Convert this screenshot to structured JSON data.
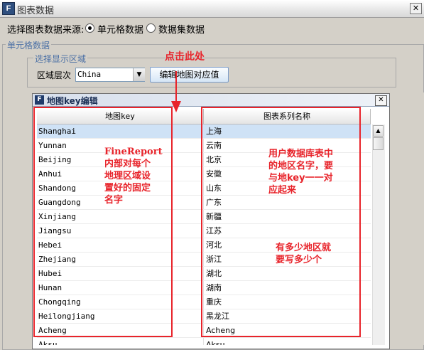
{
  "window": {
    "title": "图表数据",
    "close_glyph": "✕"
  },
  "source": {
    "label": "选择图表数据来源:",
    "options": [
      {
        "label": "单元格数据",
        "selected": true
      },
      {
        "label": "数据集数据",
        "selected": false
      }
    ]
  },
  "cell_group": {
    "legend": "单元格数据"
  },
  "display_group": {
    "legend": "选择显示区域"
  },
  "region": {
    "label": "区域层次",
    "value": "China"
  },
  "edit_button": {
    "label": "编辑地图对应值"
  },
  "map_key_dialog": {
    "title": "地图key编辑",
    "close_glyph": "✕",
    "columns": [
      "地图key",
      "图表系列名称"
    ],
    "rows": [
      {
        "key": "Shanghai",
        "name": "上海",
        "selected": true
      },
      {
        "key": "Yunnan",
        "name": "云南"
      },
      {
        "key": "Beijing",
        "name": "北京"
      },
      {
        "key": "Anhui",
        "name": "安徽"
      },
      {
        "key": "Shandong",
        "name": "山东"
      },
      {
        "key": "Guangdong",
        "name": "广东"
      },
      {
        "key": "Xinjiang",
        "name": "新疆"
      },
      {
        "key": "Jiangsu",
        "name": "江苏"
      },
      {
        "key": "Hebei",
        "name": "河北"
      },
      {
        "key": "Zhejiang",
        "name": "浙江"
      },
      {
        "key": "Hubei",
        "name": "湖北"
      },
      {
        "key": "Hunan",
        "name": "湖南"
      },
      {
        "key": "Chongqing",
        "name": "重庆"
      },
      {
        "key": "Heilongjiang",
        "name": "黑龙江"
      },
      {
        "key": "Acheng",
        "name": "Acheng"
      },
      {
        "key": "Aksu",
        "name": "Aksu"
      }
    ]
  },
  "annotations": {
    "click_here": "点击此处",
    "left_note": [
      "FineReport",
      "内部对每个",
      "地理区域设",
      "置好的固定",
      "名字"
    ],
    "right_note": [
      "用户数据库表中",
      "的地区名字，要",
      "与地key一一对",
      "应起来"
    ],
    "bottom_note": [
      "有多少地区就",
      "要写多少个"
    ]
  },
  "colors": {
    "annotation_red": "#e8242b",
    "selected_row": "#cfe2f6"
  }
}
